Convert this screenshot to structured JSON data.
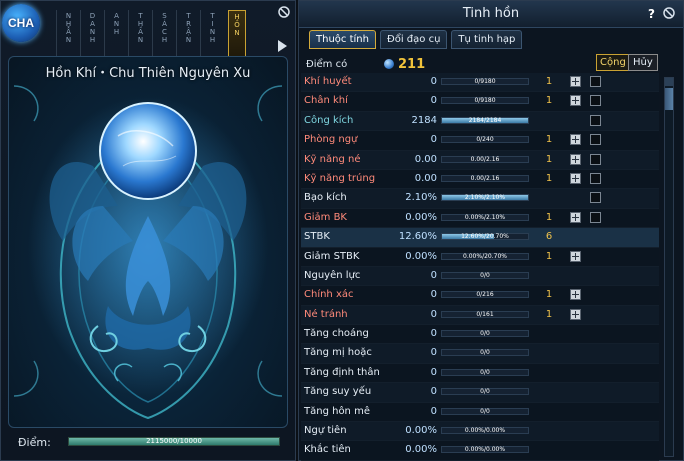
{
  "left_panel": {
    "badge": "CHA",
    "vertical_tabs": [
      {
        "label": "NHẪN",
        "active": false
      },
      {
        "label": "DANH",
        "active": false
      },
      {
        "label": "ANH",
        "active": false
      },
      {
        "label": "THẦN",
        "active": false
      },
      {
        "label": "SÁCH",
        "active": false
      },
      {
        "label": "TRẬN",
        "active": false
      },
      {
        "label": "TINH",
        "active": false
      },
      {
        "label": "HỒN",
        "active": true
      }
    ],
    "art_title": "Hồn Khí・Chu Thiên Nguyên Xu",
    "points_label": "Điểm:",
    "points_bar_text": "2115000/10000",
    "points_fill": 1.0
  },
  "right_panel": {
    "title": "Tinh hồn",
    "help": "?",
    "tabs": [
      {
        "label": "Thuộc tính",
        "active": true
      },
      {
        "label": "Đổi đạo cụ",
        "active": false
      },
      {
        "label": "Tụ tinh hạp",
        "active": false
      }
    ],
    "points_available_label": "Điểm có",
    "points_available": "211",
    "confirm_label": "Cộng",
    "cancel_label": "Hủy",
    "stats": [
      {
        "name": "Khí huyết",
        "color": "red",
        "value": "0",
        "bar": "0/9180",
        "fill": 0.0,
        "count": "1",
        "plus": true,
        "check": true
      },
      {
        "name": "Chân khí",
        "color": "red",
        "value": "0",
        "bar": "0/9180",
        "fill": 0.0,
        "count": "1",
        "plus": true,
        "check": true
      },
      {
        "name": "Công kích",
        "color": "teal",
        "value": "2184",
        "bar": "2184/2184",
        "fill": 1.0,
        "count": "",
        "plus": false,
        "check": true
      },
      {
        "name": "Phòng ngự",
        "color": "red",
        "value": "0",
        "bar": "0/240",
        "fill": 0.0,
        "count": "1",
        "plus": true,
        "check": true
      },
      {
        "name": "Kỹ năng né",
        "color": "red",
        "value": "0.00",
        "bar": "0.00/2.16",
        "fill": 0.0,
        "count": "1",
        "plus": true,
        "check": true
      },
      {
        "name": "Kỹ năng trúng",
        "color": "red",
        "value": "0.00",
        "bar": "0.00/2.16",
        "fill": 0.0,
        "count": "1",
        "plus": true,
        "check": true
      },
      {
        "name": "Bạo kích",
        "color": "white",
        "value": "2.10%",
        "bar": "2.10%/2.10%",
        "fill": 1.0,
        "count": "",
        "plus": false,
        "check": true
      },
      {
        "name": "Giảm BK",
        "color": "red",
        "value": "0.00%",
        "bar": "0.00%/2.10%",
        "fill": 0.0,
        "count": "1",
        "plus": true,
        "check": true
      },
      {
        "name": "STBK",
        "color": "white",
        "value": "12.60%",
        "bar": "12.60%/20.70%",
        "fill": 0.609,
        "count": "6",
        "plus": false,
        "check": false
      },
      {
        "name": "Giảm STBK",
        "color": "white",
        "value": "0.00%",
        "bar": "0.00%/20.70%",
        "fill": 0.0,
        "count": "1",
        "plus": true,
        "check": false
      },
      {
        "name": "Nguyên lực",
        "color": "white",
        "value": "0",
        "bar": "0/0",
        "fill": 0.0,
        "count": "",
        "plus": false,
        "check": false
      },
      {
        "name": "Chính xác",
        "color": "red",
        "value": "0",
        "bar": "0/216",
        "fill": 0.0,
        "count": "1",
        "plus": true,
        "check": false
      },
      {
        "name": "Né tránh",
        "color": "red",
        "value": "0",
        "bar": "0/161",
        "fill": 0.0,
        "count": "1",
        "plus": true,
        "check": false
      },
      {
        "name": "Tăng choáng",
        "color": "white",
        "value": "0",
        "bar": "0/0",
        "fill": 0.0,
        "count": "",
        "plus": false,
        "check": false
      },
      {
        "name": "Tăng mị hoặc",
        "color": "white",
        "value": "0",
        "bar": "0/0",
        "fill": 0.0,
        "count": "",
        "plus": false,
        "check": false
      },
      {
        "name": "Tăng định thân",
        "color": "white",
        "value": "0",
        "bar": "0/0",
        "fill": 0.0,
        "count": "",
        "plus": false,
        "check": false
      },
      {
        "name": "Tăng suy yếu",
        "color": "white",
        "value": "0",
        "bar": "0/0",
        "fill": 0.0,
        "count": "",
        "plus": false,
        "check": false
      },
      {
        "name": "Tăng hôn mê",
        "color": "white",
        "value": "0",
        "bar": "0/0",
        "fill": 0.0,
        "count": "",
        "plus": false,
        "check": false
      },
      {
        "name": "Ngự tiên",
        "color": "white",
        "value": "0.00%",
        "bar": "0.00%/0.00%",
        "fill": 0.0,
        "count": "",
        "plus": false,
        "check": false
      },
      {
        "name": "Khắc tiên",
        "color": "white",
        "value": "0.00%",
        "bar": "0.00%/0.00%",
        "fill": 0.0,
        "count": "",
        "plus": false,
        "check": false
      }
    ]
  }
}
